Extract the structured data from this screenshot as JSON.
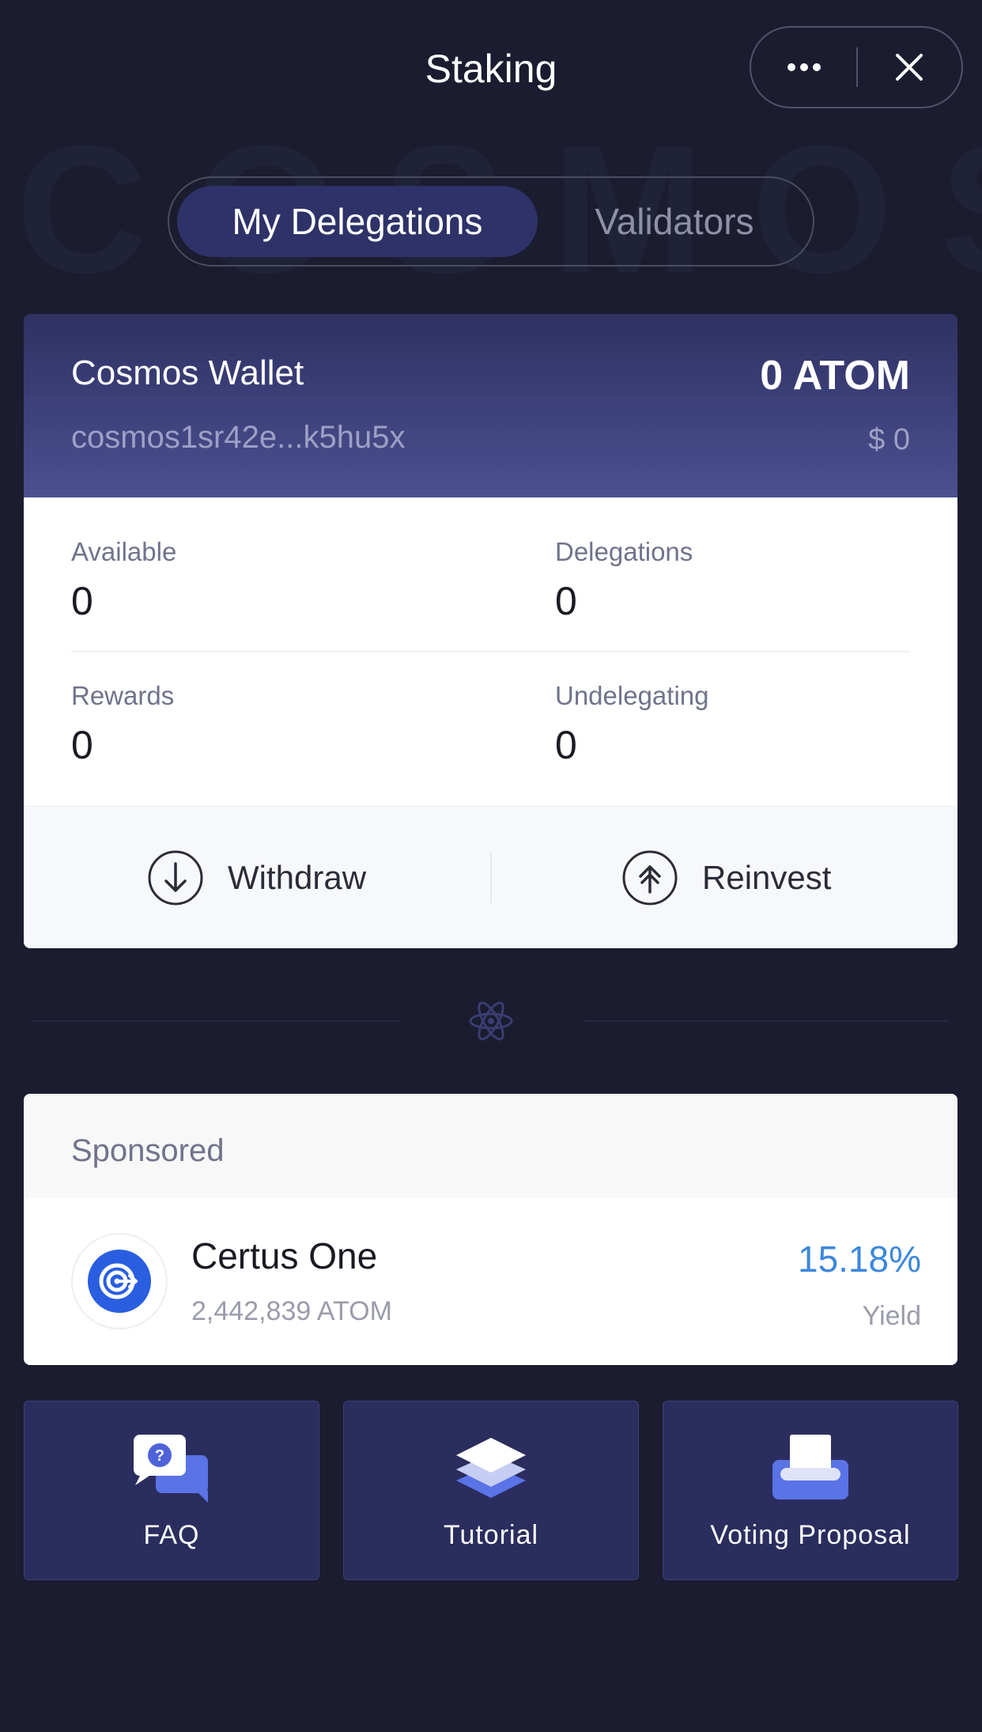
{
  "header": {
    "title": "Staking"
  },
  "watermark_text": "COSMOS",
  "tabs": [
    {
      "label": "My Delegations",
      "active": true
    },
    {
      "label": "Validators",
      "active": false
    }
  ],
  "wallet": {
    "name": "Cosmos Wallet",
    "amount": "0 ATOM",
    "address": "cosmos1sr42e...k5hu5x",
    "usd": "$ 0"
  },
  "stats": {
    "available": {
      "label": "Available",
      "value": "0"
    },
    "delegations": {
      "label": "Delegations",
      "value": "0"
    },
    "rewards": {
      "label": "Rewards",
      "value": "0"
    },
    "undelegating": {
      "label": "Undelegating",
      "value": "0"
    }
  },
  "actions": {
    "withdraw": "Withdraw",
    "reinvest": "Reinvest"
  },
  "sponsored": {
    "title": "Sponsored",
    "validator": {
      "name": "Certus One",
      "stake": "2,442,839 ATOM",
      "yield": "15.18%",
      "yield_label": "Yield"
    }
  },
  "tiles": {
    "faq": "FAQ",
    "tutorial": "Tutorial",
    "voting": "Voting Proposal"
  },
  "colors": {
    "background": "#1b1c2f",
    "accent_blue": "#3c87dc",
    "tile_bg": "#2b2d5e",
    "active_tab": "#2e3268"
  }
}
